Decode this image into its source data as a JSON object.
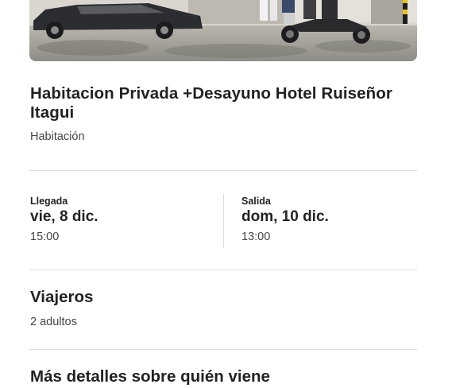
{
  "listing": {
    "title": "Habitacion Privada +Desayuno Hotel Ruiseñor Itagui",
    "type": "Habitación"
  },
  "checkin": {
    "label": "Llegada",
    "date": "vie, 8 dic.",
    "time": "15:00"
  },
  "checkout": {
    "label": "Salida",
    "date": "dom, 10 dic.",
    "time": "13:00"
  },
  "travelers": {
    "title": "Viajeros",
    "value": "2 adultos"
  },
  "details": {
    "title": "Más detalles sobre quién viene"
  }
}
